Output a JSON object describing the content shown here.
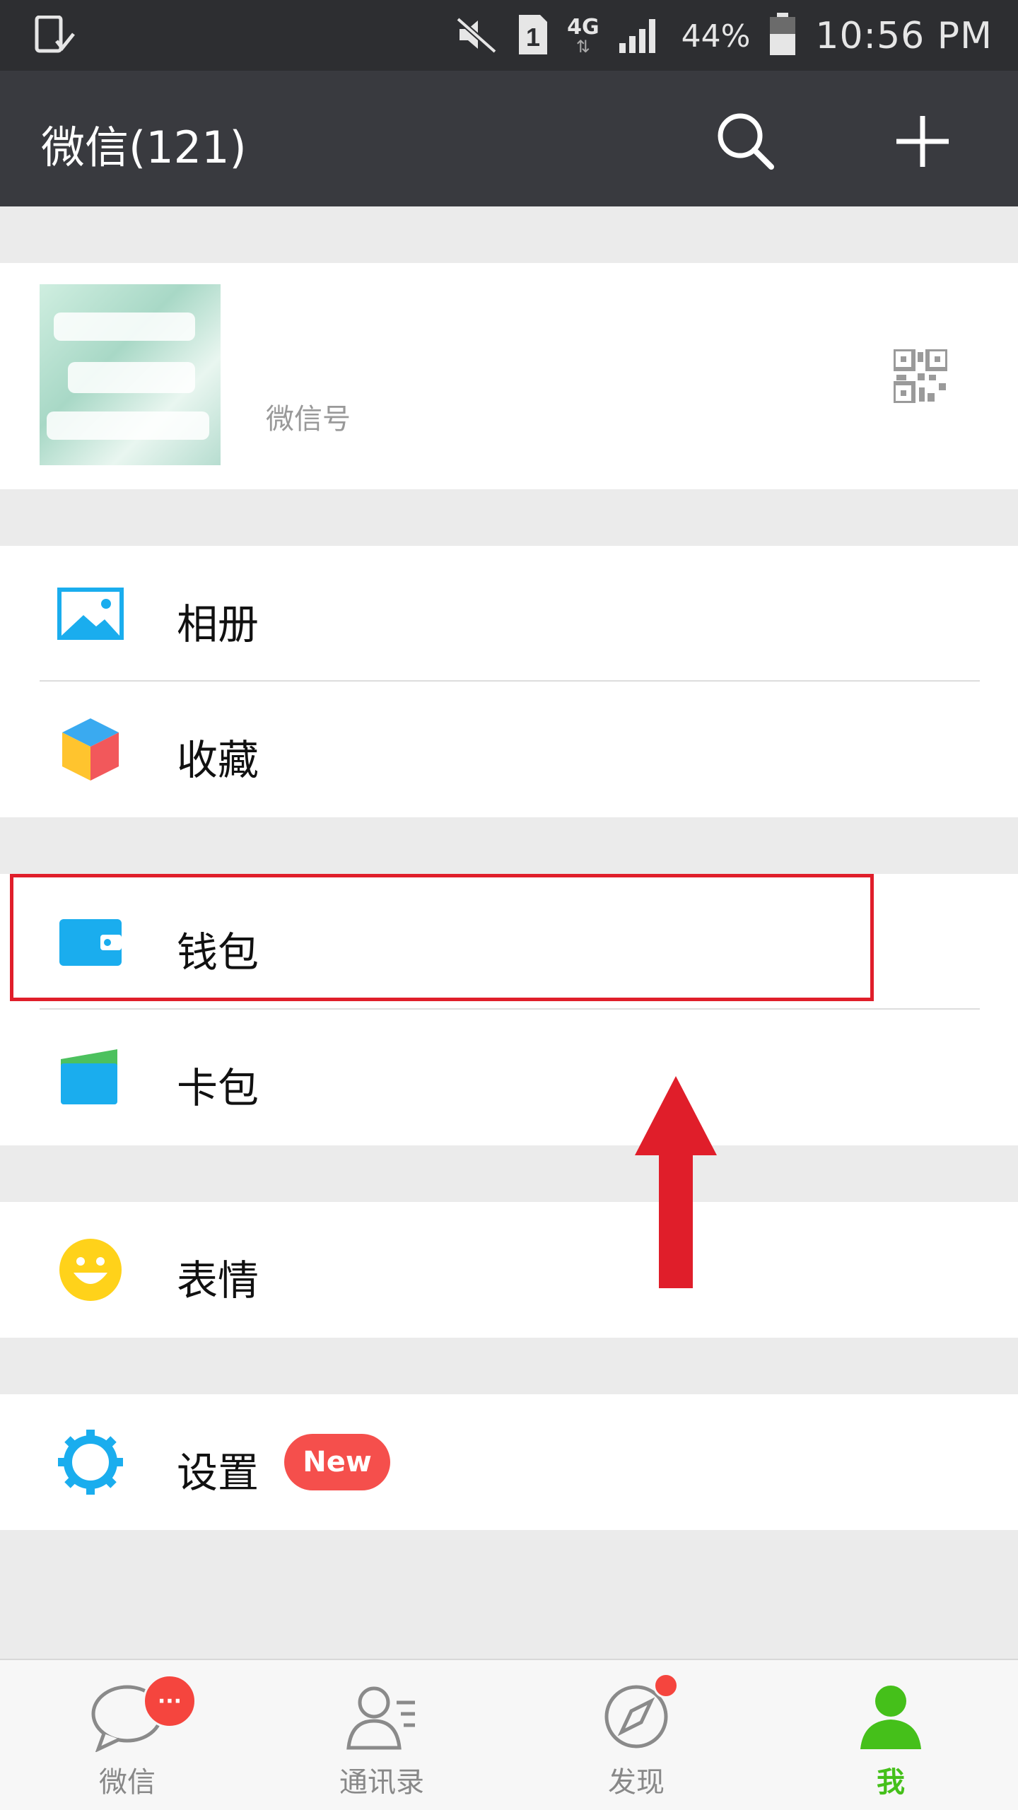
{
  "status_bar": {
    "battery": "44%",
    "time": "10:56 PM",
    "network": "4G",
    "sim": "1"
  },
  "header": {
    "title": "微信(121)"
  },
  "profile": {
    "name": "",
    "wechat_id_label": "微信号"
  },
  "menu": {
    "album": "相册",
    "favorites": "收藏",
    "wallet": "钱包",
    "cards": "卡包",
    "stickers": "表情",
    "settings": "设置",
    "settings_badge": "New"
  },
  "tabbar": {
    "chats": "微信",
    "chats_badge": "···",
    "contacts": "通讯录",
    "discover": "发现",
    "me": "我"
  },
  "colors": {
    "titlebar": "#393a3f",
    "accent_green": "#45c01a",
    "badge_red": "#f54f4c",
    "icon_blue": "#1aadee"
  }
}
